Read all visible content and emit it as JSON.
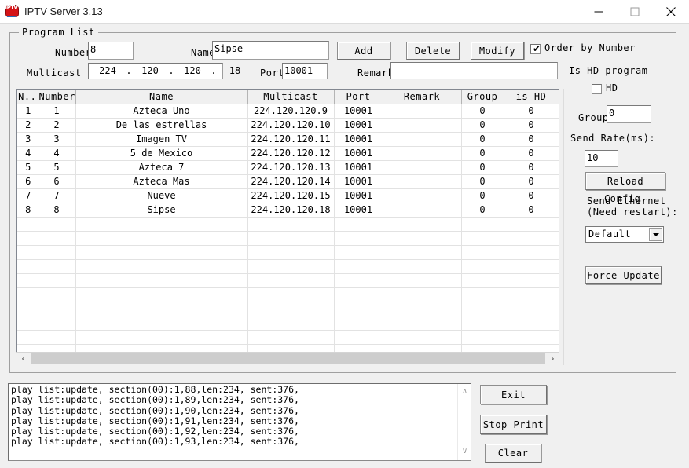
{
  "window": {
    "title": "IPTV Server 3.13",
    "icon_name": "iptv-app-icon",
    "icon_text": "IPTV",
    "minimize_label": "—",
    "maximize_label": "□",
    "close_label": "✕"
  },
  "group": {
    "legend": "Program List"
  },
  "form": {
    "number_label": "Number",
    "number_value": "8",
    "name_label": "Name",
    "name_value": "Sipse",
    "multicast_label": "Multicast",
    "multicast_octets": [
      "224",
      "120",
      "120",
      "18"
    ],
    "multicast_sep": ".",
    "port_label": "Port",
    "port_value": "10001",
    "remark_label": "Remark",
    "remark_value": ""
  },
  "actions": {
    "add_label": "Add",
    "delete_label": "Delete",
    "modify_label": "Modify",
    "order_by_number_label": "Order by Number",
    "order_by_number_checked": true,
    "order_check_glyph": "✔"
  },
  "sidebar": {
    "is_hd_program_label": "Is HD program",
    "hd_checkbox_label": "HD",
    "hd_checked": false,
    "group_label": "Group",
    "group_value": "0",
    "send_rate_label": "Send Rate(ms):",
    "send_rate_value": "10",
    "reload_config_label": "Reload Config.",
    "send_ethernet_label_line1": "Send Ethernet",
    "send_ethernet_label_line2": "(Need restart):",
    "ethernet_selected": "Default",
    "ethernet_options": [
      "Default"
    ],
    "force_update_label": "Force Update"
  },
  "table": {
    "columns": [
      "N..",
      "Number",
      "Name",
      "Multicast",
      "Port",
      "Remark",
      "Group",
      "is HD"
    ],
    "rows": [
      {
        "n": "1",
        "number": "1",
        "name": "Azteca Uno",
        "multicast": "224.120.120.9",
        "port": "10001",
        "remark": "",
        "group": "0",
        "is_hd": "0"
      },
      {
        "n": "2",
        "number": "2",
        "name": "De las estrellas",
        "multicast": "224.120.120.10",
        "port": "10001",
        "remark": "",
        "group": "0",
        "is_hd": "0"
      },
      {
        "n": "3",
        "number": "3",
        "name": "Imagen TV",
        "multicast": "224.120.120.11",
        "port": "10001",
        "remark": "",
        "group": "0",
        "is_hd": "0"
      },
      {
        "n": "4",
        "number": "4",
        "name": "5 de Mexico",
        "multicast": "224.120.120.12",
        "port": "10001",
        "remark": "",
        "group": "0",
        "is_hd": "0"
      },
      {
        "n": "5",
        "number": "5",
        "name": "Azteca 7",
        "multicast": "224.120.120.13",
        "port": "10001",
        "remark": "",
        "group": "0",
        "is_hd": "0"
      },
      {
        "n": "6",
        "number": "6",
        "name": "Azteca Mas",
        "multicast": "224.120.120.14",
        "port": "10001",
        "remark": "",
        "group": "0",
        "is_hd": "0"
      },
      {
        "n": "7",
        "number": "7",
        "name": "Nueve",
        "multicast": "224.120.120.15",
        "port": "10001",
        "remark": "",
        "group": "0",
        "is_hd": "0"
      },
      {
        "n": "8",
        "number": "8",
        "name": "Sipse",
        "multicast": "224.120.120.18",
        "port": "10001",
        "remark": "",
        "group": "0",
        "is_hd": "0"
      }
    ],
    "empty_row_count": 14,
    "hscroll_left_glyph": "‹",
    "hscroll_right_glyph": "›"
  },
  "log": {
    "lines": [
      "play list:update, section(00):1,88,len:234, sent:376,",
      "play list:update, section(00):1,89,len:234, sent:376,",
      "play list:update, section(00):1,90,len:234, sent:376,",
      "play list:update, section(00):1,91,len:234, sent:376,",
      "play list:update, section(00):1,92,len:234, sent:376,",
      "play list:update, section(00):1,93,len:234, sent:376,"
    ],
    "scroll_up_glyph": "∧",
    "scroll_down_glyph": "∨"
  },
  "bottom_buttons": {
    "exit_label": "Exit",
    "stop_print_label": "Stop Print",
    "clear_label": "Clear"
  },
  "colors": {
    "window_bg": "#f0f0f0",
    "titlebar_bg": "#ffffff",
    "field_bg": "#ffffff",
    "border": "#a0a0a0",
    "icon_red": "#d51317"
  }
}
